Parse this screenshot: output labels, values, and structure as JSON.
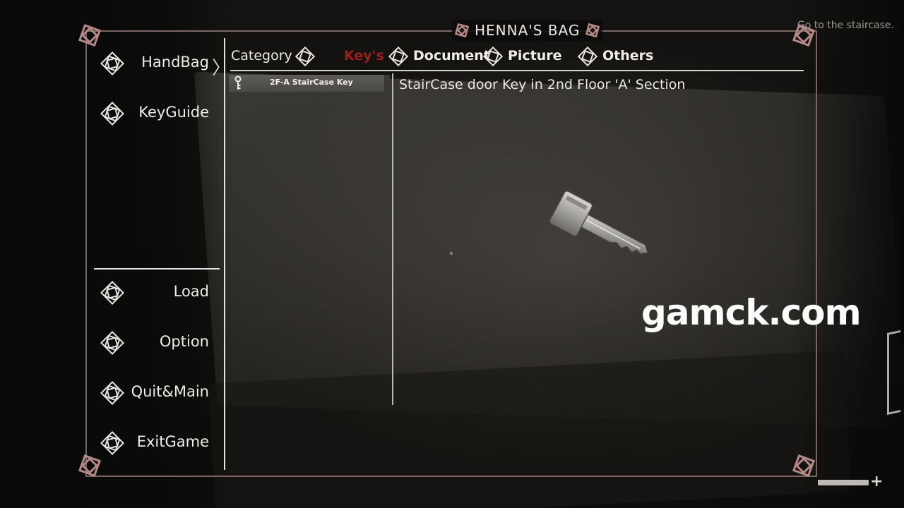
{
  "window": {
    "title": "HENNA'S BAG",
    "objective": "Go to the staircase."
  },
  "menu": {
    "items": [
      {
        "label": "HandBag",
        "icon": "diamond-icon",
        "selected": true
      },
      {
        "label": "KeyGuide",
        "icon": "diamond-icon"
      },
      {
        "label": "Load",
        "icon": "diamond-icon"
      },
      {
        "label": "Option",
        "icon": "diamond-icon"
      },
      {
        "label": "Quit&Main",
        "icon": "diamond-icon"
      },
      {
        "label": "ExitGame",
        "icon": "diamond-icon"
      }
    ],
    "selected_indicator": "〉"
  },
  "category": {
    "label": "Category",
    "tabs": [
      {
        "label": "Key's",
        "icon": "diamond-icon",
        "active": true
      },
      {
        "label": "Document",
        "icon": "diamond-icon"
      },
      {
        "label": "Picture",
        "icon": "diamond-icon"
      },
      {
        "label": "Others",
        "icon": "diamond-icon"
      }
    ]
  },
  "items": [
    {
      "label": "2F-A StairCase Key",
      "icon": "key-icon",
      "selected": true
    }
  ],
  "detail": {
    "description": "StairCase door Key in 2nd Floor 'A' Section",
    "preview": "key-model-icon"
  },
  "overlay": {
    "watermark": "gamck.com"
  },
  "hud": {
    "stamina_icon": "plus-icon",
    "stamina_fraction": 1.0
  },
  "colors": {
    "frame": "#7a6661",
    "corner_ornament": "#b58a86",
    "active_tab": "#9b1f1f",
    "text": "#ece8e3"
  }
}
